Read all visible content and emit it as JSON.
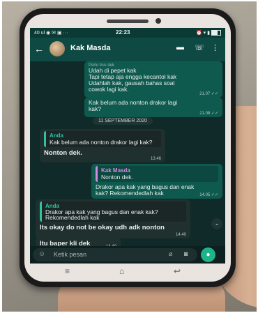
{
  "status": {
    "left": "40 ul ◉ ✉ ▣ ···",
    "time": "22:23",
    "right": "⏰ ▾ ▮"
  },
  "header": {
    "back": "←",
    "contact_name": "Kak Masda",
    "icons": {
      "video": "▬",
      "call": "☏",
      "more": "⋮"
    }
  },
  "messages": {
    "m1": {
      "quote_hint": "Perlu trus dek",
      "text": "Udah di pepet kak\nTapi tetap aja engga kecantol kak\nUdahlah kak, gausah bahas soal\ncowok lagi kak.",
      "time": "21.07 ✓✓"
    },
    "m2": {
      "text": "Kak belum ada nonton drakor lagi\nkak?",
      "time": "21.08 ✓✓"
    },
    "date": "11 SEPTEMBER 2020",
    "m3": {
      "quote_name": "Anda",
      "quote_text": "Kak belum ada nonton drakor lagi kak?",
      "text": "Nonton dek.",
      "time": "13.46"
    },
    "m4": {
      "quote_name": "Kak Masda",
      "quote_text": "Nonton dek.",
      "text": "Drakor apa kak yang bagus dan enak\nkak? Rekomendedlah kak",
      "time": "14.05 ✓✓"
    },
    "m5": {
      "quote_name": "Anda",
      "quote_text": "Drakor apa kak yang bagus dan enak kak?\nRekomendedlah kak",
      "text": "Its okay do not be okay udh adk nonton",
      "time": "14.40"
    },
    "m6": {
      "text": "Itu baper kli dek",
      "time": "14.40"
    }
  },
  "input": {
    "placeholder": "Ketik pesan",
    "emoji_icon": "☺",
    "attach_icon": "⌀",
    "camera_icon": "◙",
    "mic_icon": "●"
  },
  "nav": {
    "menu": "≡",
    "home": "⌂",
    "back": "↩"
  }
}
